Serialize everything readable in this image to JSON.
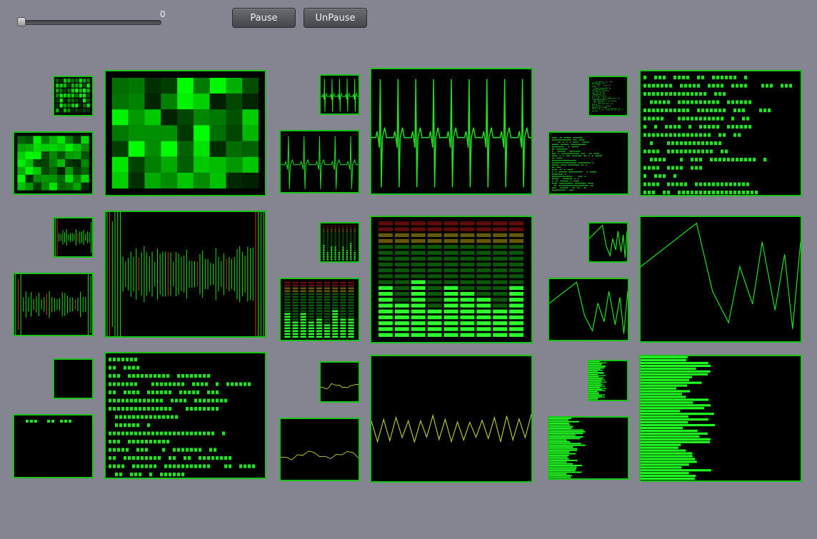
{
  "slider": {
    "value": "0",
    "position": 0.0
  },
  "buttons": {
    "pause_label": "Pause",
    "unpause_label": "UnPause"
  },
  "theme": {
    "accent": "#19c419",
    "background": "#858591",
    "panel_background": "#000000"
  },
  "visualizers": [
    {
      "name": "heatmap",
      "row": 1,
      "column": 1
    },
    {
      "name": "ecg",
      "row": 1,
      "column": 2
    },
    {
      "name": "text-stream",
      "row": 1,
      "column": 3
    },
    {
      "name": "waveform",
      "row": 2,
      "column": 1
    },
    {
      "name": "level-meter",
      "row": 2,
      "column": 2
    },
    {
      "name": "zigzag-line",
      "row": 2,
      "column": 3
    },
    {
      "name": "text-console",
      "row": 3,
      "column": 1
    },
    {
      "name": "smooth-line",
      "row": 3,
      "column": 2
    },
    {
      "name": "horizontal-bars",
      "row": 3,
      "column": 3
    }
  ]
}
